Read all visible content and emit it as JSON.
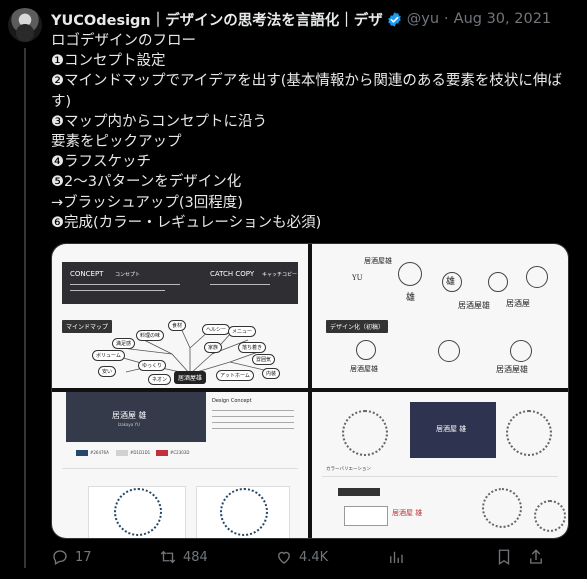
{
  "author": {
    "name": "YUCOdesign｜デザインの思考法を言語化｜デザ",
    "handle": "@yu",
    "separator": "·",
    "date": "Aug 30, 2021"
  },
  "tweet": {
    "lines": [
      "ロゴデザインのフロー",
      "❶コンセプト設定",
      "❷マインドマップでアイデアを出す(基本情報から関連のある要素を枝状に伸ばす)",
      "❸マップ内からコンセプトに沿う",
      "要素をピックアップ",
      "❹ラフスケッチ",
      "❺2〜3パターンをデザイン化",
      "→ブラッシュアップ(3回程度)",
      "❻完成(カラー・レギュレーションも必須)"
    ]
  },
  "media": {
    "img1": {
      "concept": "CONCEPT",
      "concept_ja": "コンセプト",
      "catch_copy": "CATCH COPY",
      "catch_copy_ja": "キャッチコピー",
      "section": "マインドマップ",
      "center_node": "居酒屋雄",
      "nodes": [
        "料理の味",
        "食材",
        "ヘルシー",
        "メニュー",
        "落ち着き",
        "雰囲気",
        "ボリューム",
        "満足感",
        "内装",
        "安い",
        "ゆっくり",
        "アットホーム",
        "家族",
        "ネオン"
      ]
    },
    "img2": {
      "section": "デザイン化（初稿）",
      "sketch_words": [
        "居酒屋雄",
        "雄",
        "YU",
        "居酒屋雄",
        "雄",
        "居酒屋"
      ]
    },
    "img3": {
      "brand_ja": "居酒屋 雄",
      "brand_en": "Izakaya YU",
      "design_concept": "Design Concept",
      "colors": [
        "#26476A",
        "#D1D1D1",
        "#C2303D"
      ],
      "color_labels": [
        "#26476A",
        "#D1D1D1",
        "#C2303D"
      ]
    },
    "img4": {
      "brand_ja": "居酒屋 雄",
      "section": "カラーバリエーション"
    }
  },
  "actions": {
    "replies": "17",
    "retweets": "484",
    "likes": "4.4K"
  },
  "icons": [
    "verified-icon",
    "reply-icon",
    "retweet-icon",
    "like-icon",
    "views-icon",
    "bookmark-icon",
    "share-icon"
  ],
  "colors": {
    "background": "#000000",
    "text": "#e7e9ea",
    "muted": "#71767b",
    "verified": "#1d9bf0"
  }
}
